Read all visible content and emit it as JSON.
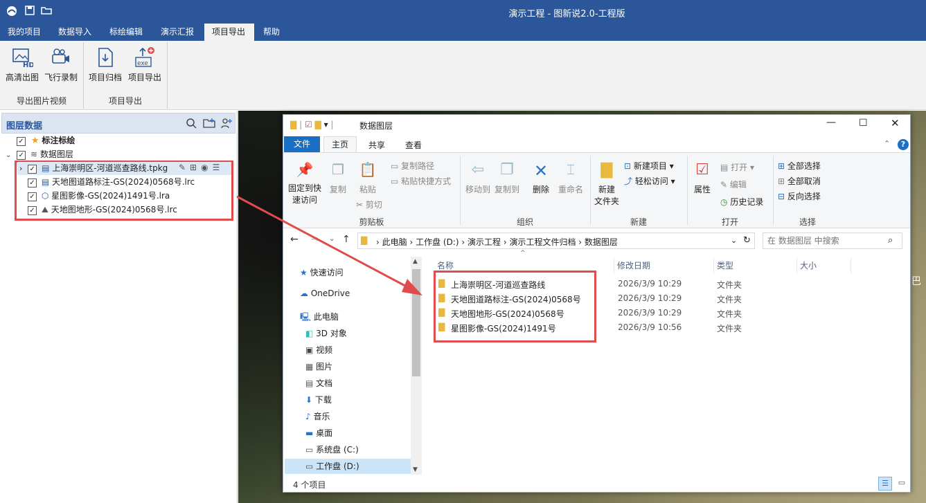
{
  "app": {
    "title": "演示工程 - 图新说2.0-工程版"
  },
  "menu": [
    "我的项目",
    "数据导入",
    "标绘编辑",
    "演示汇报",
    "项目导出",
    "帮助"
  ],
  "ribbon": {
    "buttons": [
      "高清出图",
      "飞行录制",
      "项目归档",
      "项目导出"
    ],
    "groups": [
      "导出图片视频",
      "项目导出"
    ]
  },
  "layer_panel": {
    "title": "图层数据",
    "nodes": {
      "annot": "标注标绘",
      "data": "数据图层"
    },
    "files": [
      "上海崇明区-河道巡查路线.tpkg",
      "天地图道路标注-GS(2024)0568号.lrc",
      "星图影像-GS(2024)1491号.lra",
      "天地图地形-GS(2024)0568号.lrc"
    ]
  },
  "explorer": {
    "title": "数据图层",
    "tabs": {
      "file": "文件",
      "home": "主页",
      "share": "共享",
      "view": "查看"
    },
    "ribbon": {
      "pin": "固定到快速访问",
      "pin1": "固定到快",
      "pin2": "速访问",
      "copy": "复制",
      "paste": "粘贴",
      "cut": "剪切",
      "copy_path": "复制路径",
      "paste_shortcut": "粘贴快捷方式",
      "move_to": "移动到",
      "copy_to": "复制到",
      "delete": "删除",
      "rename": "重命名",
      "new_folder1": "新建",
      "new_folder2": "文件夹",
      "new_item": "新建项目",
      "easy_access": "轻松访问",
      "properties": "属性",
      "open": "打开",
      "edit": "编辑",
      "history": "历史记录",
      "select_all": "全部选择",
      "select_none": "全部取消",
      "invert": "反向选择",
      "groups": [
        "剪贴板",
        "组织",
        "新建",
        "打开",
        "选择"
      ]
    },
    "address": [
      "此电脑",
      "工作盘 (D:)",
      "演示工程",
      "演示工程文件归档",
      "数据图层"
    ],
    "search_placeholder": "在 数据图层 中搜索",
    "nav": [
      "快速访问",
      "OneDrive",
      "此电脑",
      "3D 对象",
      "视频",
      "图片",
      "文档",
      "下载",
      "音乐",
      "桌面",
      "系统盘 (C:)",
      "工作盘 (D:)"
    ],
    "columns": [
      "名称",
      "修改日期",
      "类型",
      "大小"
    ],
    "files": [
      {
        "name": "上海崇明区-河道巡查路线",
        "date": "2026/3/9 10:29",
        "type": "文件夹"
      },
      {
        "name": "天地图道路标注-GS(2024)0568号",
        "date": "2026/3/9 10:29",
        "type": "文件夹"
      },
      {
        "name": "天地图地形-GS(2024)0568号",
        "date": "2026/3/9 10:29",
        "type": "文件夹"
      },
      {
        "name": "星图影像-GS(2024)1491号",
        "date": "2026/3/9 10:56",
        "type": "文件夹"
      }
    ],
    "status": "4 个项目"
  },
  "map": {
    "label": "巴"
  }
}
